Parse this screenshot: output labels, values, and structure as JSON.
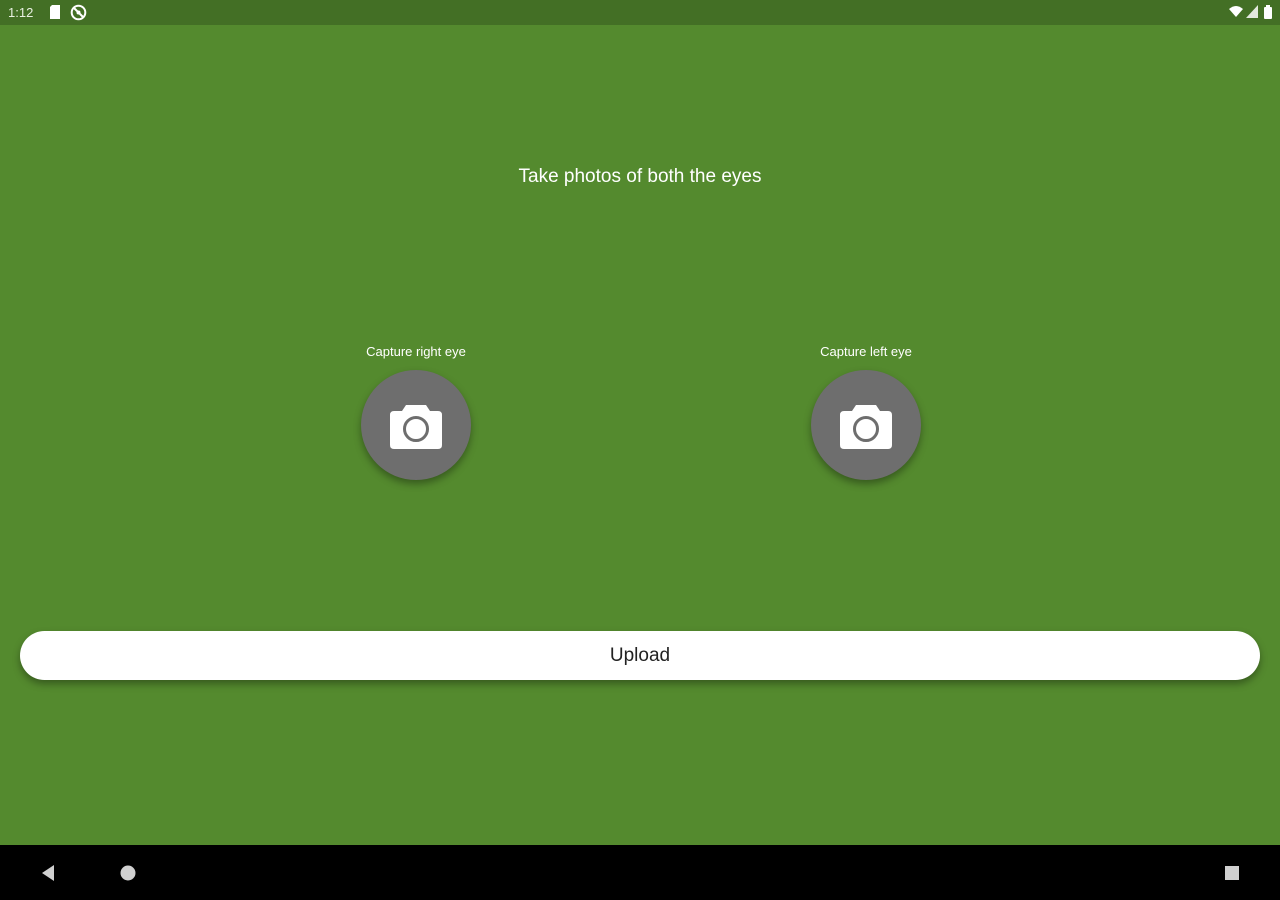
{
  "status_bar": {
    "time": "1:12",
    "icons": [
      "sd-card-icon",
      "no-location-icon",
      "wifi-icon",
      "signal-icon",
      "battery-icon"
    ]
  },
  "main": {
    "instruction": "Take photos of both the eyes",
    "right_eye": {
      "label": "Capture right eye",
      "icon": "camera-icon"
    },
    "left_eye": {
      "label": "Capture left eye",
      "icon": "camera-icon"
    },
    "upload_label": "Upload"
  },
  "nav_bar": {
    "buttons": [
      "back-icon",
      "home-icon",
      "recents-icon"
    ]
  },
  "colors": {
    "background": "#548a2e",
    "status_bar": "#436f25",
    "capture_button": "#6e6e6e",
    "upload_button": "#ffffff",
    "nav_bar": "#000000"
  }
}
